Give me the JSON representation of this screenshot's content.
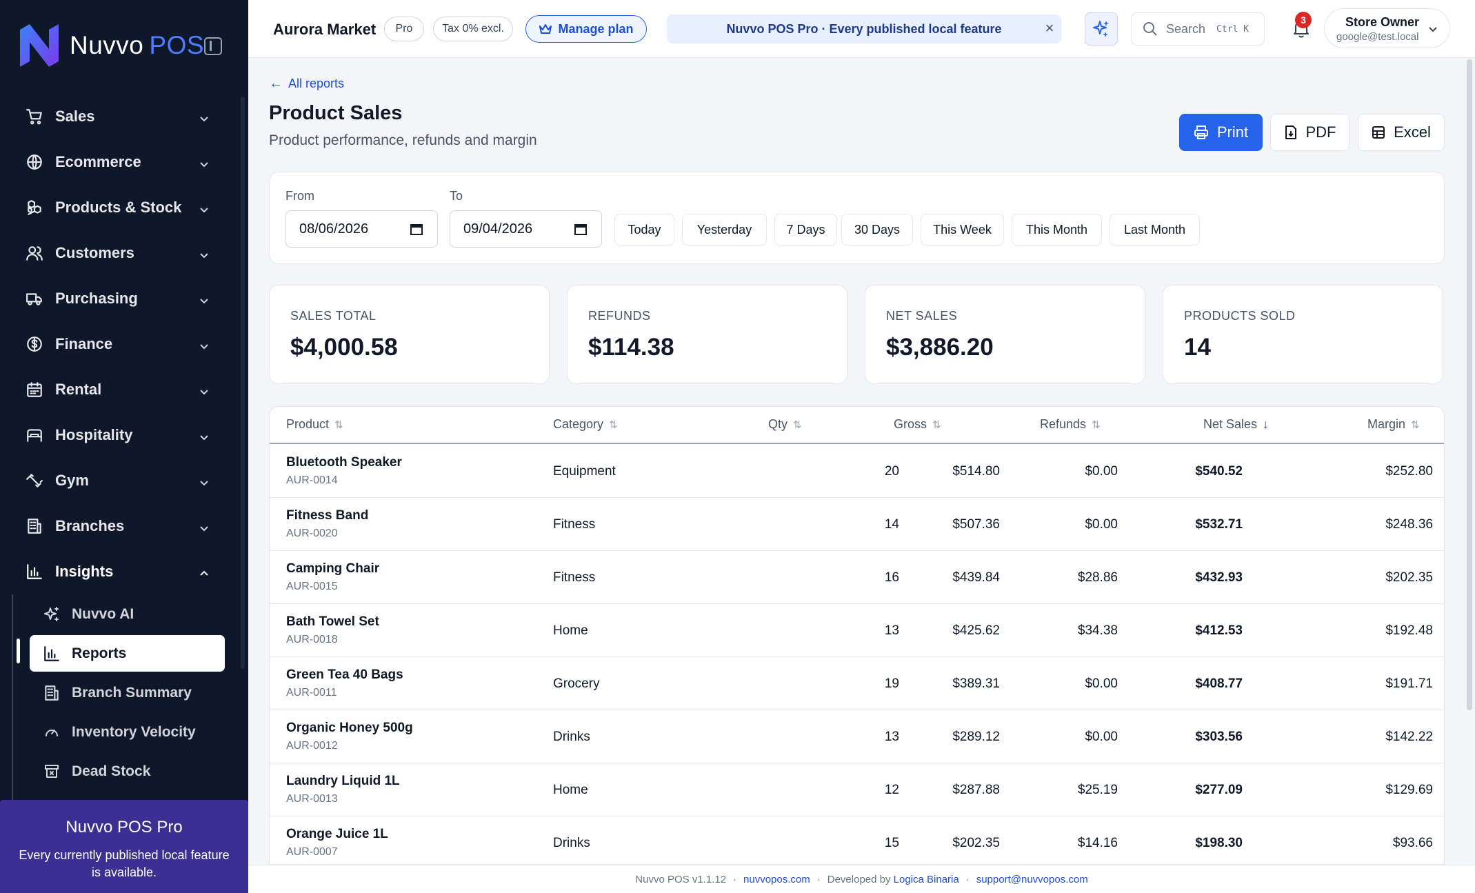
{
  "brand": {
    "name": "Nuvvo",
    "suffix": "POS"
  },
  "sidebar": {
    "items": [
      {
        "label": "Sales",
        "icon": "cart-icon"
      },
      {
        "label": "Ecommerce",
        "icon": "globe-icon"
      },
      {
        "label": "Products & Stock",
        "icon": "boxes-icon"
      },
      {
        "label": "Customers",
        "icon": "users-icon"
      },
      {
        "label": "Purchasing",
        "icon": "truck-icon"
      },
      {
        "label": "Finance",
        "icon": "dollar-icon"
      },
      {
        "label": "Rental",
        "icon": "calendar-icon"
      },
      {
        "label": "Hospitality",
        "icon": "bed-icon"
      },
      {
        "label": "Gym",
        "icon": "dumbbell-icon"
      },
      {
        "label": "Branches",
        "icon": "building-icon"
      },
      {
        "label": "Insights",
        "icon": "bar-chart-icon"
      }
    ],
    "insights_sub": [
      {
        "label": "Nuvvo AI",
        "icon": "sparkle-icon"
      },
      {
        "label": "Reports",
        "icon": "bar-chart-icon"
      },
      {
        "label": "Branch Summary",
        "icon": "building-icon"
      },
      {
        "label": "Inventory Velocity",
        "icon": "gauge-icon"
      },
      {
        "label": "Dead Stock",
        "icon": "archive-x-icon"
      }
    ],
    "promo": {
      "title": "Nuvvo POS Pro",
      "text": "Every currently published local feature is available."
    }
  },
  "topbar": {
    "store_name": "Aurora Market",
    "plan_badge": "Pro",
    "tax_badge": "Tax 0% excl.",
    "manage_plan": "Manage plan",
    "banner": "Nuvvo POS Pro · Every published local feature",
    "search_placeholder": "Search",
    "search_shortcut": "Ctrl K",
    "notifications_count": "3",
    "user": {
      "name": "Store Owner",
      "email": "google@test.local"
    }
  },
  "page": {
    "back_link": "All reports",
    "title": "Product Sales",
    "subtitle": "Product performance, refunds and margin",
    "actions": {
      "print": "Print",
      "pdf": "PDF",
      "excel": "Excel"
    }
  },
  "filters": {
    "from_label": "From",
    "from_value": "08/06/2026",
    "to_label": "To",
    "to_value": "09/04/2026",
    "quick": [
      "Today",
      "Yesterday",
      "7 Days",
      "30 Days",
      "This Week",
      "This Month",
      "Last Month"
    ]
  },
  "stats": [
    {
      "label": "SALES TOTAL",
      "value": "$4,000.58"
    },
    {
      "label": "REFUNDS",
      "value": "$114.38"
    },
    {
      "label": "NET SALES",
      "value": "$3,886.20"
    },
    {
      "label": "PRODUCTS SOLD",
      "value": "14"
    }
  ],
  "table": {
    "columns": [
      "Product",
      "Category",
      "Qty",
      "Gross",
      "Refunds",
      "Net Sales",
      "Margin"
    ],
    "sorted_column": "Net Sales",
    "sort_direction": "desc",
    "rows": [
      {
        "product": "Bluetooth Speaker",
        "sku": "AUR-0014",
        "category": "Equipment",
        "qty": "20",
        "gross": "$514.80",
        "refunds": "$0.00",
        "net": "$540.52",
        "margin": "$252.80"
      },
      {
        "product": "Fitness Band",
        "sku": "AUR-0020",
        "category": "Fitness",
        "qty": "14",
        "gross": "$507.36",
        "refunds": "$0.00",
        "net": "$532.71",
        "margin": "$248.36"
      },
      {
        "product": "Camping Chair",
        "sku": "AUR-0015",
        "category": "Fitness",
        "qty": "16",
        "gross": "$439.84",
        "refunds": "$28.86",
        "net": "$432.93",
        "margin": "$202.35"
      },
      {
        "product": "Bath Towel Set",
        "sku": "AUR-0018",
        "category": "Home",
        "qty": "13",
        "gross": "$425.62",
        "refunds": "$34.38",
        "net": "$412.53",
        "margin": "$192.48"
      },
      {
        "product": "Green Tea 40 Bags",
        "sku": "AUR-0011",
        "category": "Grocery",
        "qty": "19",
        "gross": "$389.31",
        "refunds": "$0.00",
        "net": "$408.77",
        "margin": "$191.71"
      },
      {
        "product": "Organic Honey 500g",
        "sku": "AUR-0012",
        "category": "Drinks",
        "qty": "13",
        "gross": "$289.12",
        "refunds": "$0.00",
        "net": "$303.56",
        "margin": "$142.22"
      },
      {
        "product": "Laundry Liquid 1L",
        "sku": "AUR-0013",
        "category": "Home",
        "qty": "12",
        "gross": "$287.88",
        "refunds": "$25.19",
        "net": "$277.09",
        "margin": "$129.69"
      },
      {
        "product": "Orange Juice 1L",
        "sku": "AUR-0007",
        "category": "Drinks",
        "qty": "15",
        "gross": "$202.35",
        "refunds": "$14.16",
        "net": "$198.30",
        "margin": "$93.66"
      }
    ]
  },
  "footer": {
    "version": "Nuvvo POS v1.1.12",
    "site": "nuvvopos.com",
    "developed_by": "Developed by",
    "developer": "Logica Binaria",
    "support": "support@nuvvopos.com"
  },
  "colors": {
    "sidebar_bg": "#0f172a",
    "accent": "#2563eb",
    "promo_bg": "#3b2f94",
    "badge": "#dc2626"
  }
}
